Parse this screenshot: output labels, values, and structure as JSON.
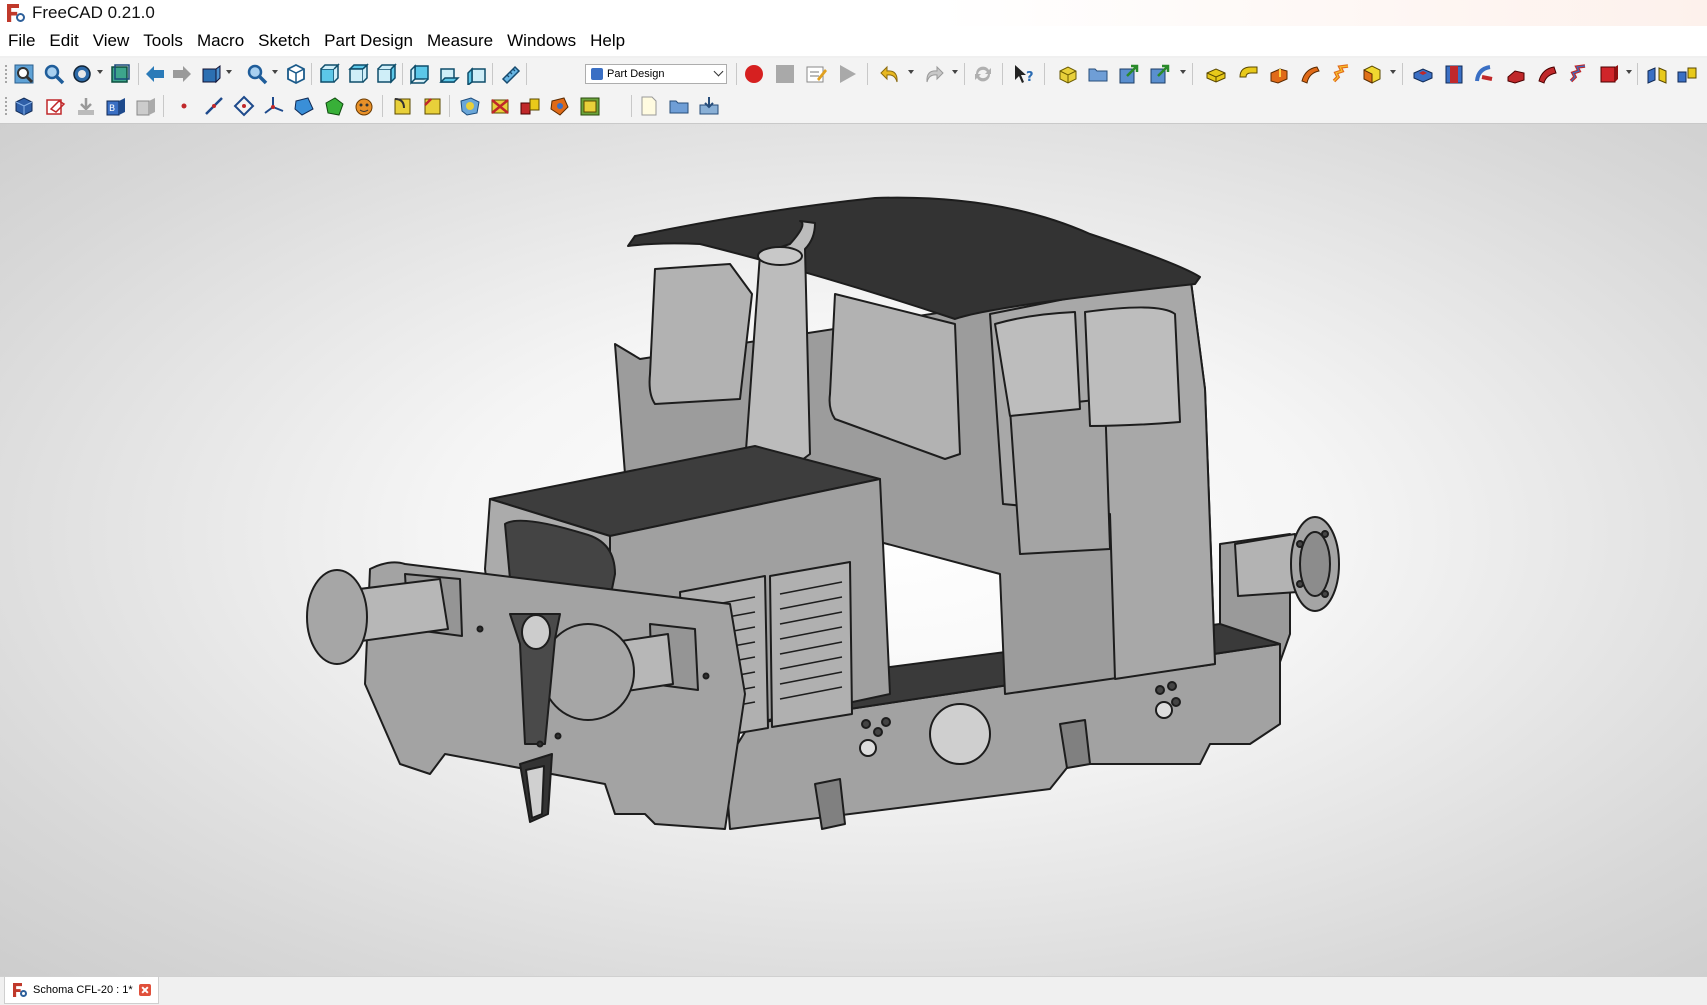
{
  "window": {
    "title": "FreeCAD 0.21.0"
  },
  "menu": [
    "File",
    "Edit",
    "View",
    "Tools",
    "Macro",
    "Sketch",
    "Part Design",
    "Measure",
    "Windows",
    "Help"
  ],
  "toolbar1": {
    "workbench_selector": {
      "selected": "Part Design"
    },
    "icons": [
      "fit-all-icon",
      "fit-selection-icon",
      "draw-style-icon",
      "bounding-box-icon",
      "back-icon",
      "forward-icon",
      "sync-view-icon",
      "std-views-icon",
      "isometric-icon",
      "front-view-icon",
      "top-view-icon",
      "right-view-icon",
      "rear-view-icon",
      "bottom-view-icon",
      "left-view-icon",
      "measure-distance-icon",
      "macro-record-icon",
      "macro-stop-icon",
      "macro-edit-icon",
      "macro-run-icon",
      "undo-icon",
      "redo-icon",
      "refresh-icon",
      "whats-this-icon",
      "part-icon",
      "group-icon",
      "link-icon",
      "link-actions-icon",
      "pad-icon",
      "revolution-icon",
      "additive-loft-icon",
      "additive-pipe-icon",
      "additive-helix-icon",
      "additive-primitive-icon",
      "pocket-icon",
      "hole-icon",
      "groove-icon",
      "subtractive-loft-icon",
      "subtractive-pipe-icon",
      "subtractive-helix-icon",
      "subtractive-primitive-icon",
      "mirrored-icon",
      "linear-pattern-icon"
    ]
  },
  "toolbar2": {
    "icons": [
      "body-icon",
      "new-sketch-icon",
      "validate-sketch-icon",
      "shape-binder-icon",
      "clone-icon",
      "datum-point-icon",
      "datum-line-icon",
      "datum-plane-icon",
      "local-cs-icon",
      "sub-shape-binder-icon",
      "shape-binder2-icon",
      "clone2-icon",
      "fillet-icon",
      "chamfer-icon",
      "draft-icon",
      "thickness-icon",
      "multi-transform-icon",
      "boolean-icon",
      "new-document-icon",
      "open-document-icon",
      "save-document-icon"
    ]
  },
  "viewport": {
    "background": "#e8e8e8",
    "model_color": "#9b9b9b",
    "roof_color": "#2f2f2f"
  },
  "document_tab": {
    "label": "Schoma CFL-20 : 1*"
  }
}
